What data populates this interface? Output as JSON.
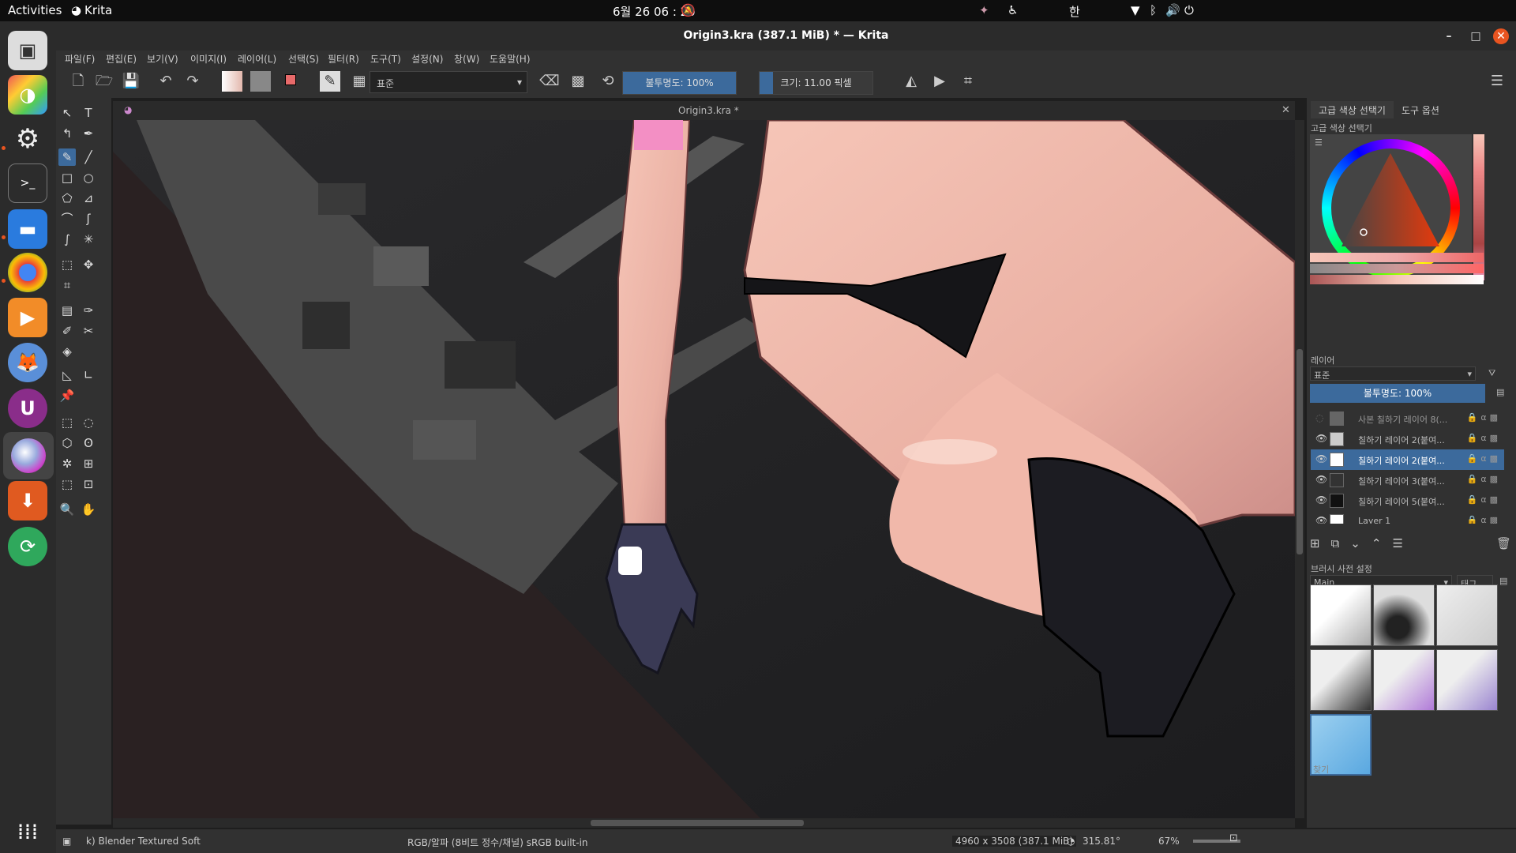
{
  "topbar": {
    "activities": "Activities",
    "app_name": "Krita",
    "clock": "6월 26 06 : 20",
    "input_method": "한"
  },
  "window": {
    "title": "Origin3.kra (387.1 MiB)  * — Krita"
  },
  "menu": [
    "파일(F)",
    "편집(E)",
    "보기(V)",
    "이미지(I)",
    "레이어(L)",
    "선택(S)",
    "필터(R)",
    "도구(T)",
    "설정(N)",
    "창(W)",
    "도움말(H)"
  ],
  "toolbar": {
    "blend_mode": "표준",
    "opacity_label": "불투명도: 100%",
    "opacity_fraction": 1.0,
    "size_label": "크기: 11.00 픽셀",
    "size_fraction": 0.12
  },
  "document": {
    "tab_title": "Origin3.kra *"
  },
  "dockers": {
    "tab_color": "고급 색상 선택기",
    "tab_tool_options": "도구 옵션",
    "color_selector_title": "고급 색상 선택기",
    "layers_title": "레이어",
    "layer_blend": "표준",
    "layer_opacity": "불투명도: 100%",
    "layers": [
      {
        "name": "사본 칠하기 레이어 8(...",
        "visible": false,
        "selected": false
      },
      {
        "name": "칠하기 레이어 2(붙여...",
        "visible": true,
        "selected": false
      },
      {
        "name": "칠하기 레이어 2(붙여...",
        "visible": true,
        "selected": true
      },
      {
        "name": "칠하기 레이어 3(붙여...",
        "visible": true,
        "selected": false
      },
      {
        "name": "칠하기 레이어 5(붙여...",
        "visible": true,
        "selected": false
      },
      {
        "name": "Layer 1",
        "visible": true,
        "selected": false
      }
    ],
    "brush_presets_title": "브러시 사전 설정",
    "preset_group": "Main",
    "tag_label": "태그",
    "search_placeholder": "찾기"
  },
  "status": {
    "brush": "k) Blender Textured Soft",
    "color_space": "RGB/알파 (8비트 정수/채널)  sRGB built-in",
    "doc_size": "4960 x 3508 (387.1 MiB)",
    "rotation": "315.81°",
    "zoom": "67%"
  },
  "colors": {
    "accent": "#3c6a9c",
    "ubuntu_orange": "#e95420",
    "close_button": "#e95420"
  }
}
